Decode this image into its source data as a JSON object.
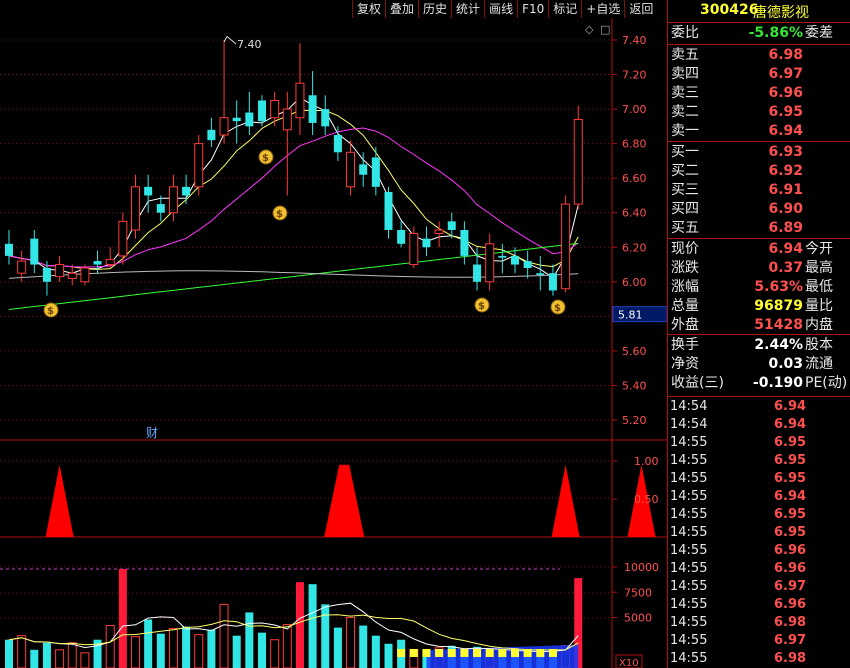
{
  "toolbar": [
    "复权",
    "叠加",
    "历史",
    "统计",
    "画线",
    "F10",
    "标记",
    "+自选",
    "返回"
  ],
  "stock": {
    "code": "300426",
    "name": "唐德影视"
  },
  "order_book": {
    "weibi_label": "委比",
    "weibi_value": "-5.86%",
    "weicha_label": "委差",
    "asks": [
      {
        "label": "卖五",
        "price": "6.98"
      },
      {
        "label": "卖四",
        "price": "6.97"
      },
      {
        "label": "卖三",
        "price": "6.96"
      },
      {
        "label": "卖二",
        "price": "6.95"
      },
      {
        "label": "卖一",
        "price": "6.94"
      }
    ],
    "bids": [
      {
        "label": "买一",
        "price": "6.93"
      },
      {
        "label": "买二",
        "price": "6.92"
      },
      {
        "label": "买三",
        "price": "6.91"
      },
      {
        "label": "买四",
        "price": "6.90"
      },
      {
        "label": "买五",
        "price": "6.89"
      }
    ]
  },
  "quote": [
    {
      "label": "现价",
      "value": "6.94",
      "label2": "今开",
      "color": "red"
    },
    {
      "label": "涨跌",
      "value": "0.37",
      "label2": "最高",
      "color": "red"
    },
    {
      "label": "涨幅",
      "value": "5.63%",
      "label2": "最低",
      "color": "red"
    },
    {
      "label": "总量",
      "value": "96879",
      "label2": "量比",
      "color": "yellow"
    },
    {
      "label": "外盘",
      "value": "51428",
      "label2": "内盘",
      "color": "red"
    }
  ],
  "fundamentals": [
    {
      "label": "换手",
      "value": "2.44%",
      "label2": "股本",
      "color": "white"
    },
    {
      "label": "净资",
      "value": "0.03",
      "label2": "流通",
      "color": "white"
    },
    {
      "label": "收益(三)",
      "value": "-0.190",
      "label2": "PE(动)",
      "color": "white"
    }
  ],
  "ticks": [
    {
      "time": "14:54",
      "price": "6.94"
    },
    {
      "time": "14:54",
      "price": "6.94"
    },
    {
      "time": "14:55",
      "price": "6.95"
    },
    {
      "time": "14:55",
      "price": "6.95"
    },
    {
      "time": "14:55",
      "price": "6.95"
    },
    {
      "time": "14:55",
      "price": "6.94"
    },
    {
      "time": "14:55",
      "price": "6.95"
    },
    {
      "time": "14:55",
      "price": "6.95"
    },
    {
      "time": "14:55",
      "price": "6.96"
    },
    {
      "time": "14:55",
      "price": "6.96"
    },
    {
      "time": "14:55",
      "price": "6.97"
    },
    {
      "time": "14:55",
      "price": "6.96"
    },
    {
      "time": "14:55",
      "price": "6.98"
    },
    {
      "time": "14:55",
      "price": "6.97"
    },
    {
      "time": "14:55",
      "price": "6.98"
    }
  ],
  "chart_data": {
    "type": "candlestick",
    "price_axis_ticks": [
      "7.40",
      "7.20",
      "7.00",
      "6.80",
      "6.60",
      "6.40",
      "6.20",
      "6.00",
      "5.80",
      "5.60",
      "5.40",
      "5.20"
    ],
    "price_ylim": [
      5.12,
      7.5
    ],
    "high_label": "7.40",
    "current_marker": "5.81",
    "finance_marker": "财",
    "indicator_ticks": [
      "1.00",
      "0.50"
    ],
    "volume_ticks": [
      "10000",
      "7500",
      "5000"
    ],
    "volume_unit": "X10",
    "candles": [
      [
        6.22,
        6.15,
        6.3,
        6.1
      ],
      [
        6.05,
        6.12,
        6.18,
        6.0
      ],
      [
        6.25,
        6.1,
        6.3,
        6.05
      ],
      [
        6.08,
        6.0,
        6.12,
        5.92
      ],
      [
        6.03,
        6.1,
        6.15,
        6.0
      ],
      [
        6.02,
        6.05,
        6.1,
        5.98
      ],
      [
        6.0,
        6.08,
        6.1,
        5.98
      ],
      [
        6.12,
        6.1,
        6.18,
        6.05
      ],
      [
        6.1,
        6.13,
        6.2,
        6.08
      ],
      [
        6.15,
        6.35,
        6.4,
        6.1
      ],
      [
        6.3,
        6.55,
        6.62,
        6.25
      ],
      [
        6.55,
        6.5,
        6.62,
        6.4
      ],
      [
        6.45,
        6.4,
        6.5,
        6.35
      ],
      [
        6.4,
        6.55,
        6.62,
        6.35
      ],
      [
        6.55,
        6.5,
        6.62,
        6.45
      ],
      [
        6.55,
        6.8,
        6.85,
        6.5
      ],
      [
        6.88,
        6.82,
        6.95,
        6.78
      ],
      [
        6.85,
        6.95,
        7.4,
        6.8
      ],
      [
        6.95,
        6.93,
        7.05,
        6.8
      ],
      [
        6.98,
        6.9,
        7.1,
        6.85
      ],
      [
        7.05,
        6.93,
        7.08,
        6.9
      ],
      [
        6.95,
        7.05,
        7.1,
        6.9
      ],
      [
        6.88,
        7.0,
        7.1,
        6.5
      ],
      [
        6.95,
        7.15,
        7.38,
        6.85
      ],
      [
        7.08,
        6.92,
        7.22,
        6.85
      ],
      [
        7.0,
        6.9,
        7.08,
        6.85
      ],
      [
        6.85,
        6.75,
        6.9,
        6.7
      ],
      [
        6.55,
        6.75,
        6.82,
        6.5
      ],
      [
        6.68,
        6.62,
        6.75,
        6.55
      ],
      [
        6.72,
        6.55,
        6.78,
        6.5
      ],
      [
        6.52,
        6.3,
        6.55,
        6.25
      ],
      [
        6.3,
        6.22,
        6.35,
        6.2
      ],
      [
        6.1,
        6.28,
        6.32,
        6.08
      ],
      [
        6.25,
        6.2,
        6.32,
        6.15
      ],
      [
        6.28,
        6.3,
        6.35,
        6.2
      ],
      [
        6.35,
        6.3,
        6.4,
        6.25
      ],
      [
        6.3,
        6.15,
        6.35,
        6.1
      ],
      [
        6.1,
        6.0,
        6.2,
        5.95
      ],
      [
        6.0,
        6.22,
        6.28,
        5.95
      ],
      [
        6.15,
        6.14,
        6.22,
        6.05
      ],
      [
        6.15,
        6.1,
        6.2,
        6.05
      ],
      [
        6.12,
        6.08,
        6.18,
        6.02
      ],
      [
        6.05,
        6.04,
        6.15,
        5.95
      ],
      [
        6.05,
        5.95,
        6.1,
        5.92
      ],
      [
        5.96,
        6.45,
        6.5,
        5.94
      ],
      [
        6.45,
        6.94,
        7.02,
        6.42
      ]
    ],
    "signals": [
      [
        4,
        0.95
      ],
      [
        26.5,
        0.95
      ],
      [
        44,
        0.95
      ],
      [
        50,
        0.95
      ]
    ],
    "volumes": [
      2800,
      3200,
      1800,
      2500,
      1800,
      2500,
      1500,
      2800,
      4200,
      9800,
      3100,
      4800,
      3400,
      3900,
      4100,
      3300,
      3800,
      6300,
      3200,
      5500,
      3500,
      2800,
      4300,
      8500,
      8300,
      6300,
      4000,
      5000,
      4200,
      3200,
      2400,
      2800,
      1800,
      1700,
      2000,
      2200,
      1800,
      2100,
      1500,
      1600,
      1700,
      1500,
      1800,
      1700,
      2200,
      8900
    ]
  }
}
